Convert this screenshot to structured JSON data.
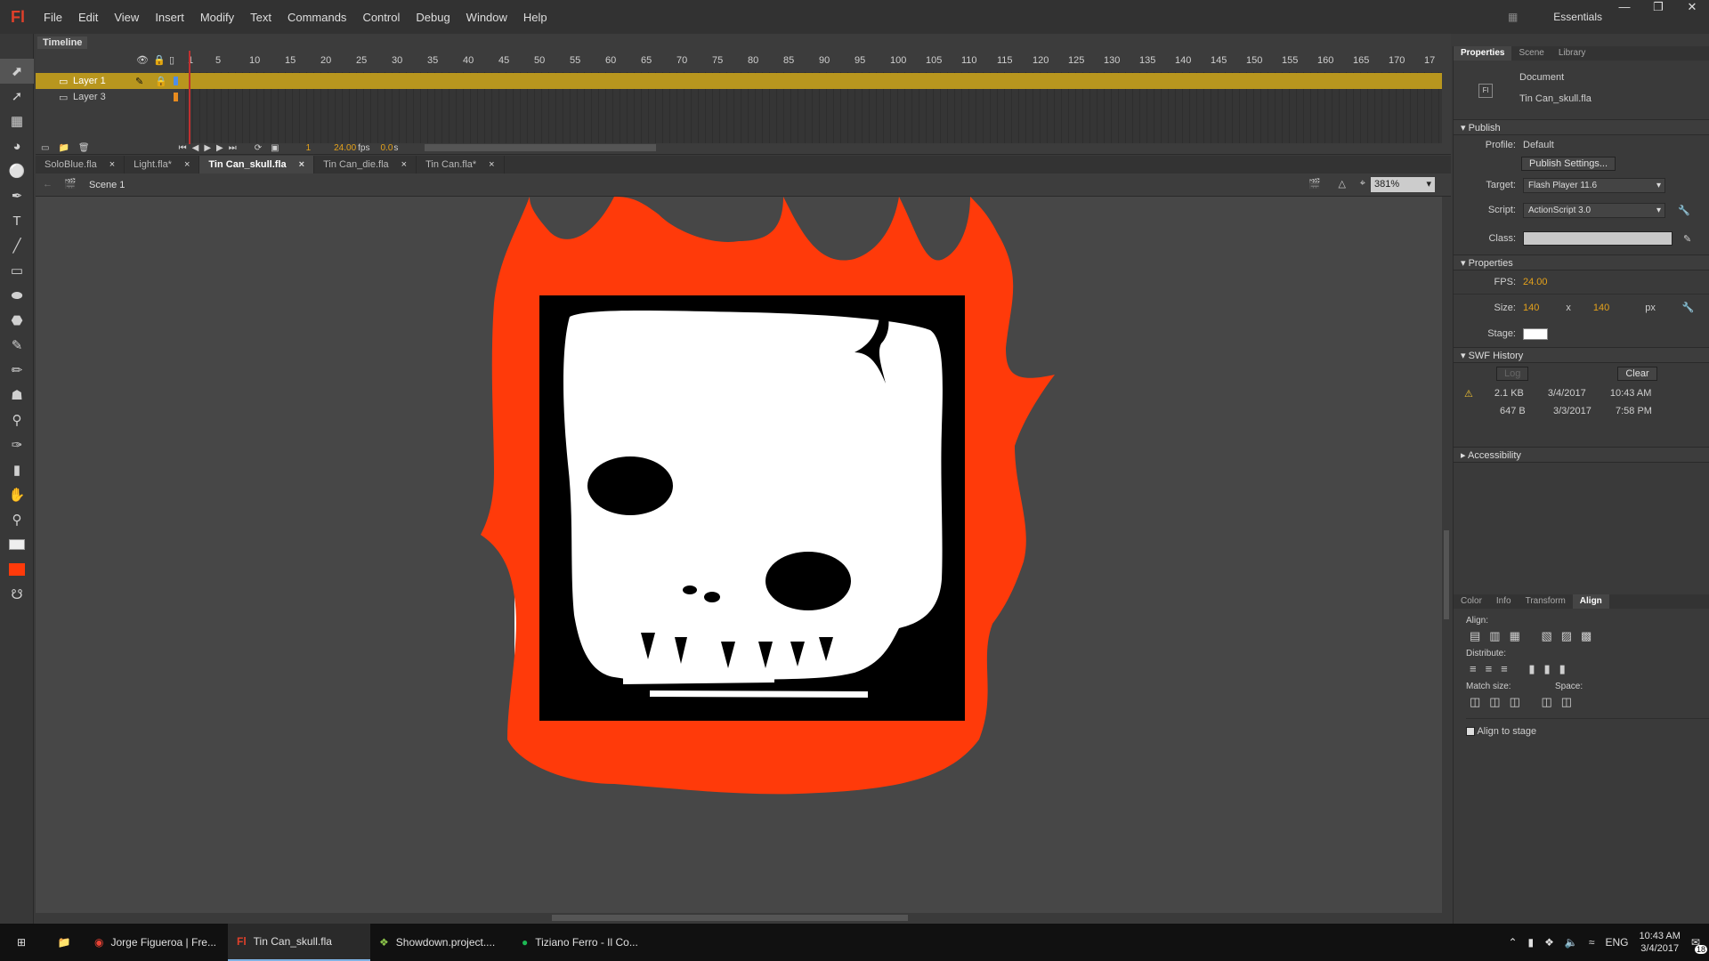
{
  "app": {
    "logo": "Fl",
    "workspace": "Essentials"
  },
  "menu": [
    "File",
    "Edit",
    "View",
    "Insert",
    "Modify",
    "Text",
    "Commands",
    "Control",
    "Debug",
    "Window",
    "Help"
  ],
  "timeline": {
    "tab": "Timeline",
    "frame_numbers": [
      "1",
      "5",
      "10",
      "15",
      "20",
      "25",
      "30",
      "35",
      "40",
      "45",
      "50",
      "55",
      "60",
      "65",
      "70",
      "75",
      "80",
      "85",
      "90",
      "95",
      "100",
      "105",
      "110",
      "115",
      "120",
      "125",
      "130",
      "135",
      "140",
      "145",
      "150",
      "155",
      "160",
      "165",
      "170",
      "17"
    ],
    "layers": [
      {
        "name": "Layer 1",
        "selected": true
      },
      {
        "name": "Layer 3",
        "selected": false
      }
    ],
    "current_frame": "1",
    "fps": "24.00",
    "fps_unit": "fps",
    "time": "0.0",
    "time_unit": "s"
  },
  "doc_tabs": [
    {
      "label": "SoloBlue.fla",
      "active": false
    },
    {
      "label": "Light.fla*",
      "active": false
    },
    {
      "label": "Tin Can_skull.fla",
      "active": true
    },
    {
      "label": "Tin Can_die.fla",
      "active": false
    },
    {
      "label": "Tin Can.fla*",
      "active": false
    }
  ],
  "editbar": {
    "scene": "Scene 1",
    "zoom": "381%"
  },
  "panel": {
    "tabs": [
      "Properties",
      "Scene",
      "Library"
    ],
    "doc_type": "Document",
    "doc_name": "Tin Can_skull.fla",
    "publish": {
      "title": "Publish",
      "profile_label": "Profile:",
      "profile": "Default",
      "settings_button": "Publish Settings...",
      "target_label": "Target:",
      "target": "Flash Player 11.6",
      "script_label": "Script:",
      "script": "ActionScript 3.0",
      "class_label": "Class:"
    },
    "properties": {
      "title": "Properties",
      "fps_label": "FPS:",
      "fps": "24.00",
      "size_label": "Size:",
      "width": "140",
      "x": "x",
      "height": "140",
      "unit": "px",
      "stage_label": "Stage:"
    },
    "swf_history": {
      "title": "SWF History",
      "log_button": "Log",
      "clear_button": "Clear",
      "entries": [
        {
          "size": "2.1 KB",
          "date": "3/4/2017",
          "time": "10:43 AM"
        },
        {
          "size": "647 B",
          "date": "3/3/2017",
          "time": "7:58 PM"
        }
      ]
    },
    "accessibility": "Accessibility",
    "lower_tabs": [
      "Color",
      "Info",
      "Transform",
      "Align"
    ],
    "align": {
      "align_label": "Align:",
      "distribute_label": "Distribute:",
      "match_label": "Match size:",
      "space_label": "Space:",
      "stage_checkbox": "Align to stage"
    }
  },
  "taskbar": {
    "items": [
      {
        "label": "Jorge Figueroa | Fre...",
        "active": false
      },
      {
        "label": "Tin Can_skull.fla",
        "active": true
      },
      {
        "label": "Showdown.project....",
        "active": false
      },
      {
        "label": "Tiziano Ferro - Il Co...",
        "active": false
      }
    ],
    "lang": "ENG",
    "time": "10:43 AM",
    "date": "3/4/2017",
    "notifications": "18"
  },
  "colors": {
    "flame": "#ff3a0a",
    "stage_bg": "#474747",
    "selected_layer": "#b8961e",
    "accent_orange": "#e4a11b"
  }
}
